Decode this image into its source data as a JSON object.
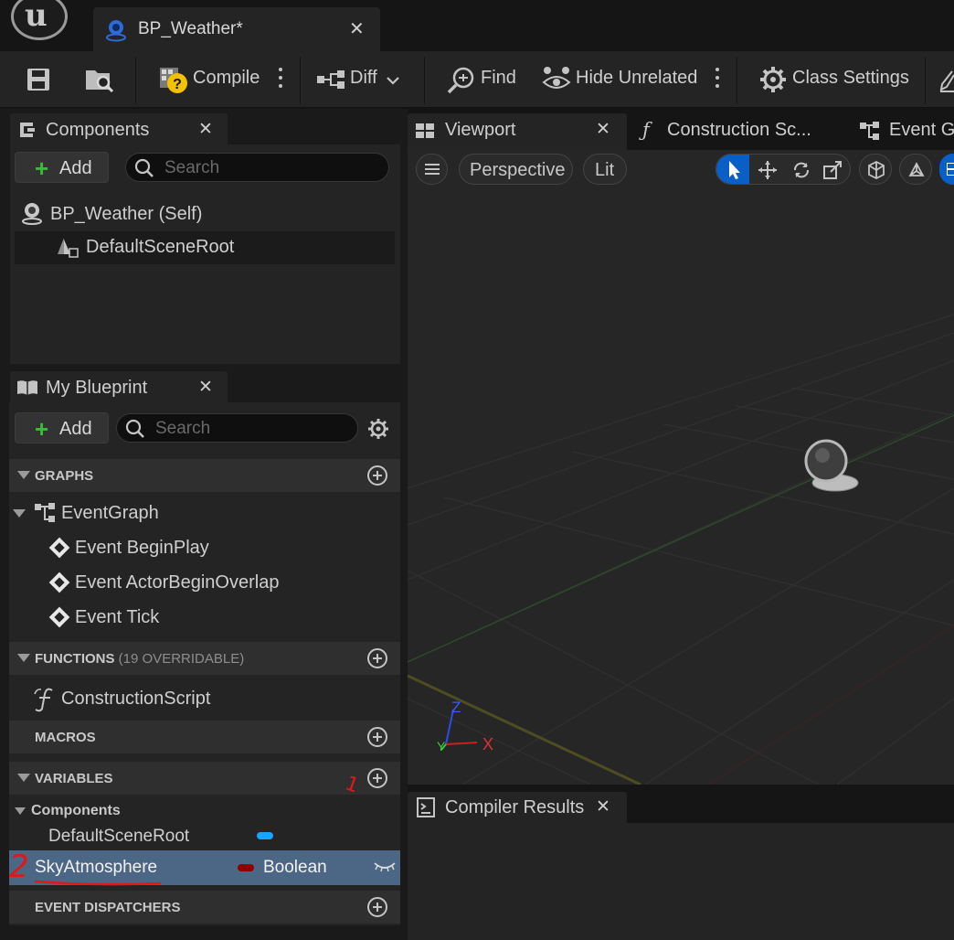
{
  "document_tab": {
    "title": "BP_Weather*"
  },
  "toolbar": {
    "compile": "Compile",
    "diff": "Diff",
    "find": "Find",
    "hide_unrelated": "Hide Unrelated",
    "class_settings": "Class Settings"
  },
  "components_panel": {
    "tab_label": "Components",
    "add_label": "Add",
    "search_placeholder": "Search",
    "tree": [
      {
        "label": "BP_Weather (Self)"
      },
      {
        "label": "DefaultSceneRoot"
      }
    ]
  },
  "my_blueprint": {
    "tab_label": "My Blueprint",
    "add_label": "Add",
    "search_placeholder": "Search",
    "graphs_label": "GRAPHS",
    "event_graph": "EventGraph",
    "events": [
      "Event BeginPlay",
      "Event ActorBeginOverlap",
      "Event Tick"
    ],
    "functions_label": "FUNCTIONS",
    "functions_sub": "(19 OVERRIDABLE)",
    "construction_script": "ConstructionScript",
    "macros_label": "MACROS",
    "variables_label": "VARIABLES",
    "components_category": "Components",
    "variables": [
      {
        "name": "DefaultSceneRoot",
        "type": "",
        "color": "#1aa3ff"
      },
      {
        "name": "SkyAtmosphere",
        "type": "Boolean",
        "color": "#8e0000"
      }
    ],
    "event_dispatchers_label": "EVENT DISPATCHERS"
  },
  "annotations": [
    "1",
    "2"
  ],
  "viewport_tabs": [
    {
      "label": "Viewport"
    },
    {
      "label": "Construction Sc..."
    },
    {
      "label": "Event Gr"
    }
  ],
  "viewport": {
    "perspective": "Perspective",
    "lit": "Lit",
    "axis_x": "X",
    "axis_y": "Y",
    "axis_z": "Z"
  },
  "compiler_results": {
    "tab_label": "Compiler Results"
  },
  "colors": {
    "accent_blue": "#0a5fc6",
    "add_green": "#3cbb3c",
    "selection": "#4c6685",
    "annotation_red": "#e01818"
  }
}
